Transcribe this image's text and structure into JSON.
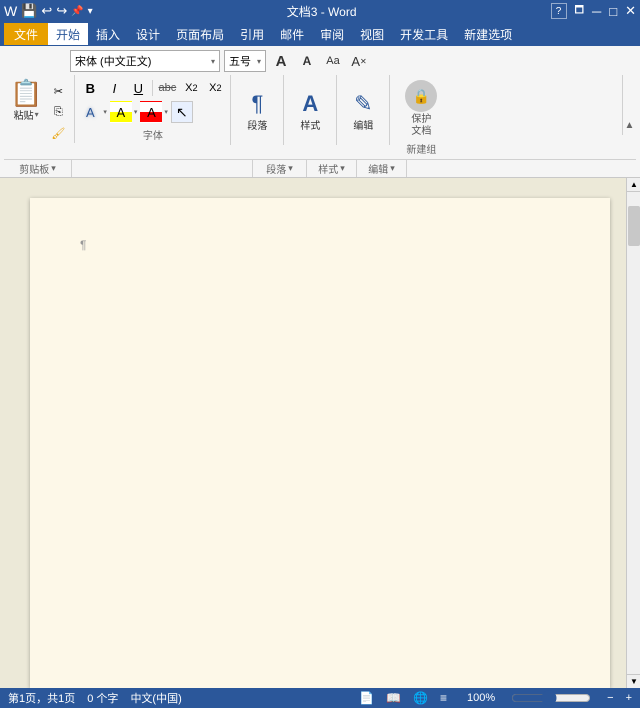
{
  "titlebar": {
    "title": "文档3 - Word",
    "left_icons": [
      "📄",
      "💾",
      "↩",
      "↪",
      "📌"
    ],
    "right_icons": [
      "?",
      "🗖",
      "─",
      "□",
      "✕"
    ]
  },
  "menubar": {
    "file_label": "文件",
    "items": [
      "开始",
      "插入",
      "设计",
      "页面布局",
      "引用",
      "邮件",
      "审阅",
      "视图",
      "开发工具",
      "新建选项"
    ]
  },
  "ribbon": {
    "groups": {
      "clipboard": {
        "label": "剪贴板",
        "paste_label": "粘贴",
        "cut_label": "剪切",
        "copy_label": "复制",
        "format_painter_label": "格式刷"
      },
      "font": {
        "label": "字体",
        "font_name": "宋体 (中文正文)",
        "font_size": "五号",
        "bold": "B",
        "italic": "I",
        "underline": "U",
        "strikethrough": "abc",
        "subscript": "X₂",
        "superscript": "X²",
        "clear_format": "A",
        "font_color": "A",
        "highlight": "A",
        "increase_size": "A",
        "decrease_size": "A",
        "phonetic": "Aa",
        "case": "Aa"
      },
      "paragraph": {
        "label": "段落",
        "icon": "≡"
      },
      "styles": {
        "label": "样式",
        "icon": "A"
      },
      "editing": {
        "label": "编辑",
        "icon": "✎"
      },
      "protect": {
        "label": "新建组",
        "protect_doc_label": "保护\n文档"
      }
    },
    "expand_label": "▾"
  },
  "statusbar": {
    "page_info": "第1页，共1页",
    "word_count": "0 个字",
    "lang": "中文(中国)"
  },
  "document": {
    "paragraph_mark": "¶"
  }
}
